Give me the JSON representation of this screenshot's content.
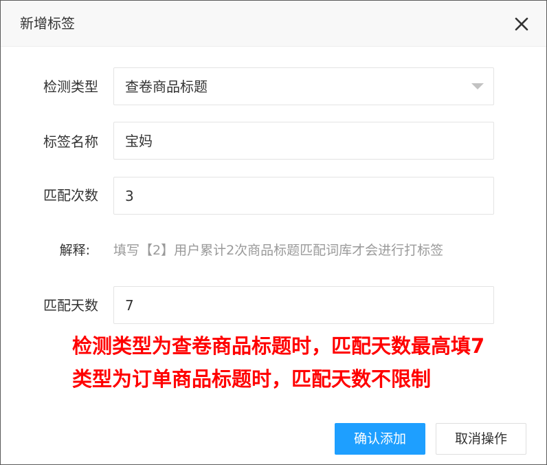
{
  "dialog": {
    "title": "新增标签",
    "close_icon": "close-icon"
  },
  "form": {
    "detect_type": {
      "label": "检测类型",
      "value": "查卷商品标题",
      "icon": "chevron-down-icon"
    },
    "tag_name": {
      "label": "标签名称",
      "value": "宝妈"
    },
    "match_count": {
      "label": "匹配次数",
      "value": "3"
    },
    "hint": {
      "label": "解释:",
      "text": "填写【2】用户累计2次商品标题匹配词库才会进行打标签"
    },
    "match_days": {
      "label": "匹配天数",
      "value": "7"
    }
  },
  "annotations": {
    "line1": "检测类型为查卷商品标题时，匹配天数最高填7",
    "line2": "类型为订单商品标题时，匹配天数不限制"
  },
  "footer": {
    "confirm_label": "确认添加",
    "cancel_label": "取消操作"
  },
  "colors": {
    "primary": "#1e9fff",
    "annotation": "#ff0000",
    "hint": "#9a9a9a"
  }
}
